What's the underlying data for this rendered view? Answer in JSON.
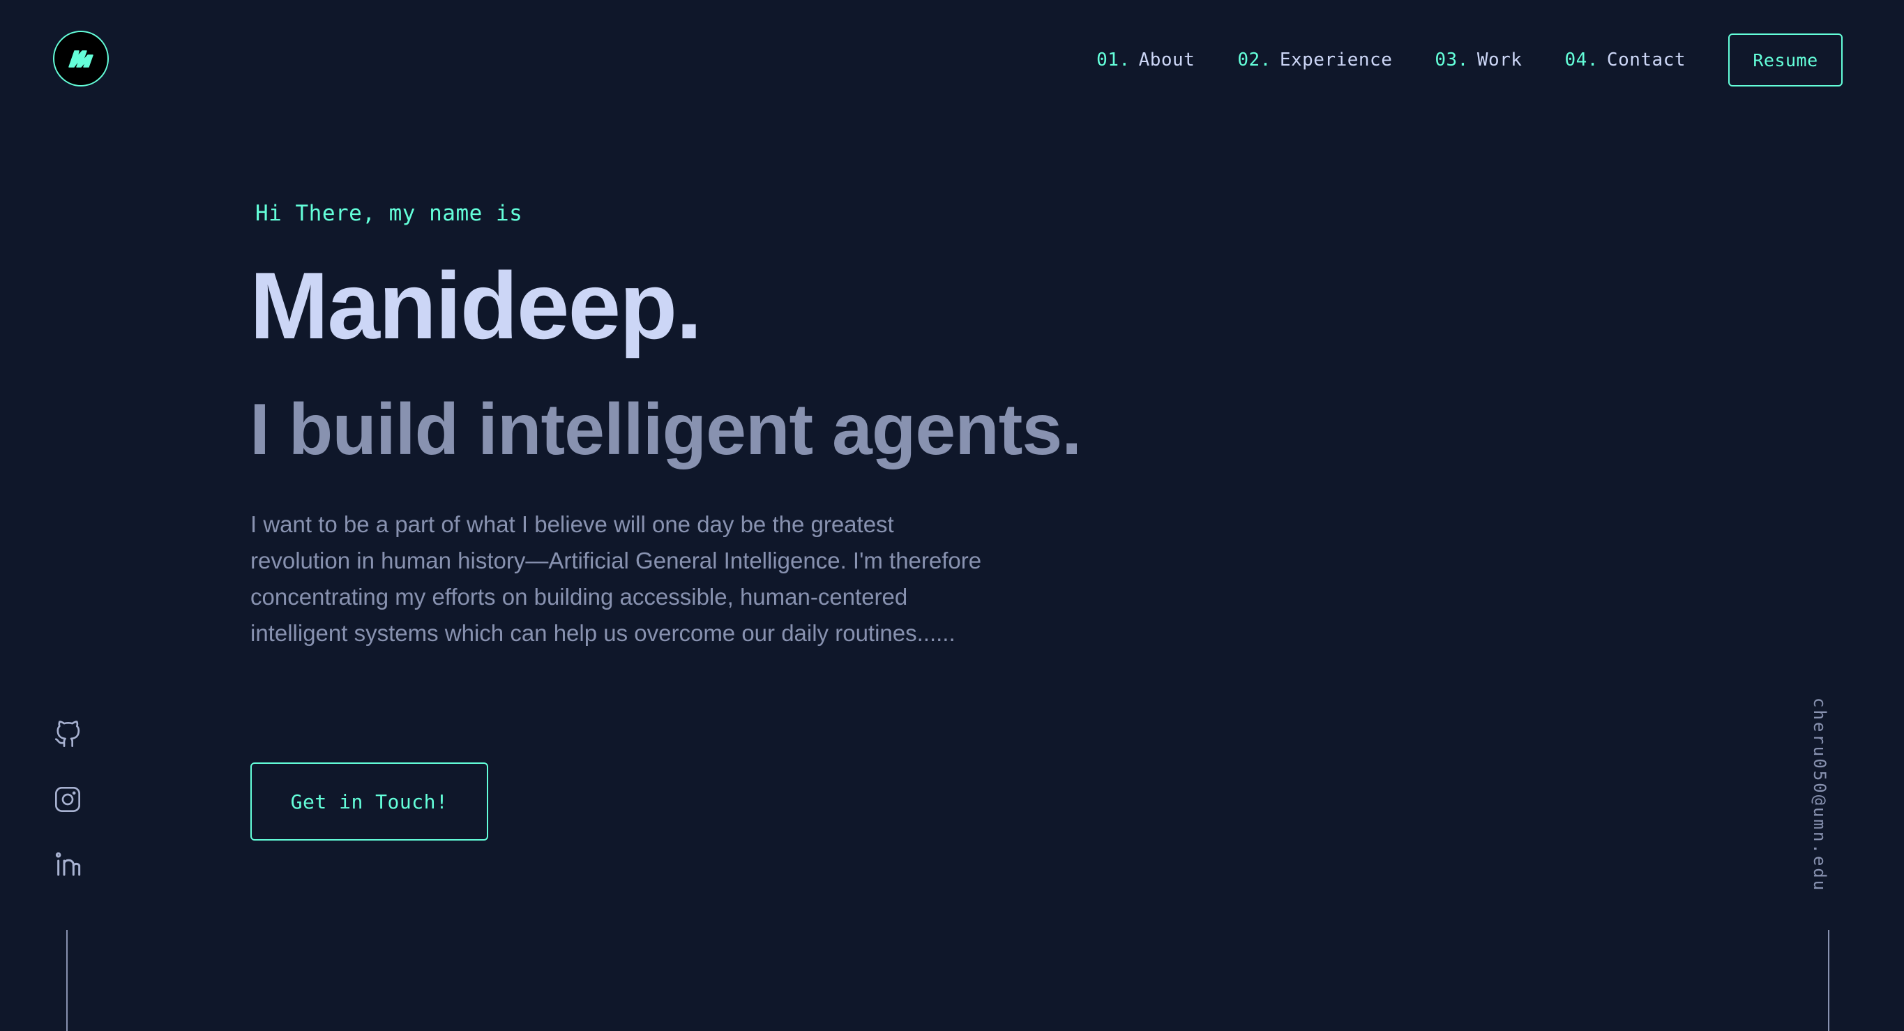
{
  "header": {
    "logo_icon": "monogram-m-logo",
    "nav": [
      {
        "num": "01.",
        "label": "About"
      },
      {
        "num": "02.",
        "label": "Experience"
      },
      {
        "num": "03.",
        "label": "Work"
      },
      {
        "num": "04.",
        "label": "Contact"
      }
    ],
    "resume_label": "Resume"
  },
  "hero": {
    "greeting": "Hi There, my name is",
    "name": "Manideep.",
    "tagline": "I build intelligent agents.",
    "bio": "I want to be a part of what I believe will one day be the greatest revolution in human history—Artificial General Intelligence. I'm therefore concentrating my efforts on building accessible, human-centered intelligent systems which can help us overcome our daily routines......",
    "cta_label": "Get in Touch!"
  },
  "social": [
    {
      "icon": "github-icon"
    },
    {
      "icon": "instagram-icon"
    },
    {
      "icon": "linkedin-icon"
    }
  ],
  "email": "cheru050@umn.edu",
  "colors": {
    "background": "#0f172a",
    "accent": "#64ffda",
    "heading": "#ccd6f6",
    "muted": "#8892b0"
  }
}
